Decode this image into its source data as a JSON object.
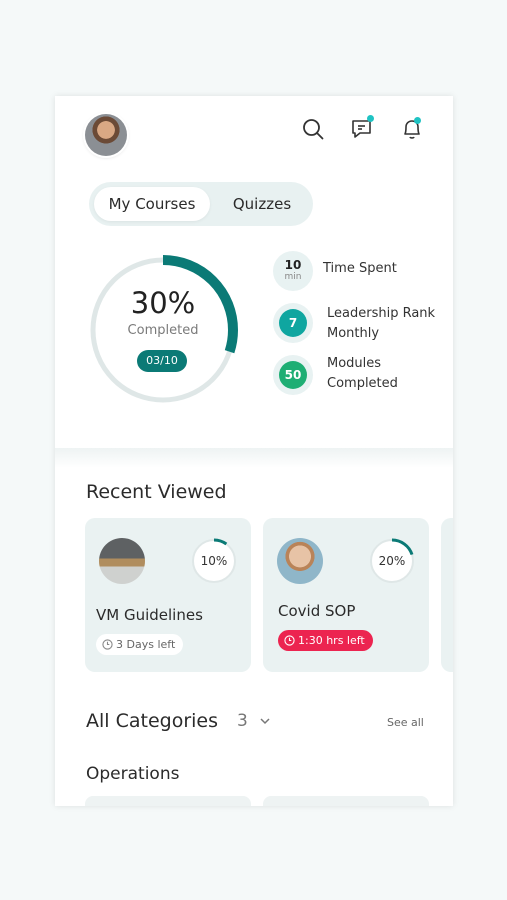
{
  "header": {
    "avatar_alt": "profile-photo",
    "icons": [
      "search-icon",
      "chat-icon",
      "bell-icon"
    ],
    "accent": "#1fc3c3"
  },
  "tabs": [
    {
      "label": "My Courses",
      "active": true
    },
    {
      "label": "Quizzes",
      "active": false
    }
  ],
  "progress": {
    "percent_text": "30%",
    "percent_value": 0.3,
    "label": "Completed",
    "count": "03/10",
    "color": "#0b7a76"
  },
  "stats": [
    {
      "value": "10",
      "unit": "min",
      "label": "Time Spent"
    },
    {
      "value": "7",
      "label_line1": "Leadership Rank",
      "label_line2": "Monthly",
      "color": "#0fa6a0"
    },
    {
      "value": "50",
      "label_line1": "Modules",
      "label_line2": "Completed",
      "color": "#1eae74"
    }
  ],
  "recent": {
    "title": "Recent Viewed",
    "cards": [
      {
        "title": "VM Guidelines",
        "percent_text": "10%",
        "percent_value": 0.1,
        "time_left": "3 Days left",
        "urgent": false
      },
      {
        "title": "Covid SOP",
        "percent_text": "20%",
        "percent_value": 0.2,
        "time_left": "1:30 hrs left",
        "urgent": true
      }
    ]
  },
  "categories": {
    "title": "All Categories",
    "count": "3",
    "see_all": "See all",
    "subsection": "Operations"
  }
}
